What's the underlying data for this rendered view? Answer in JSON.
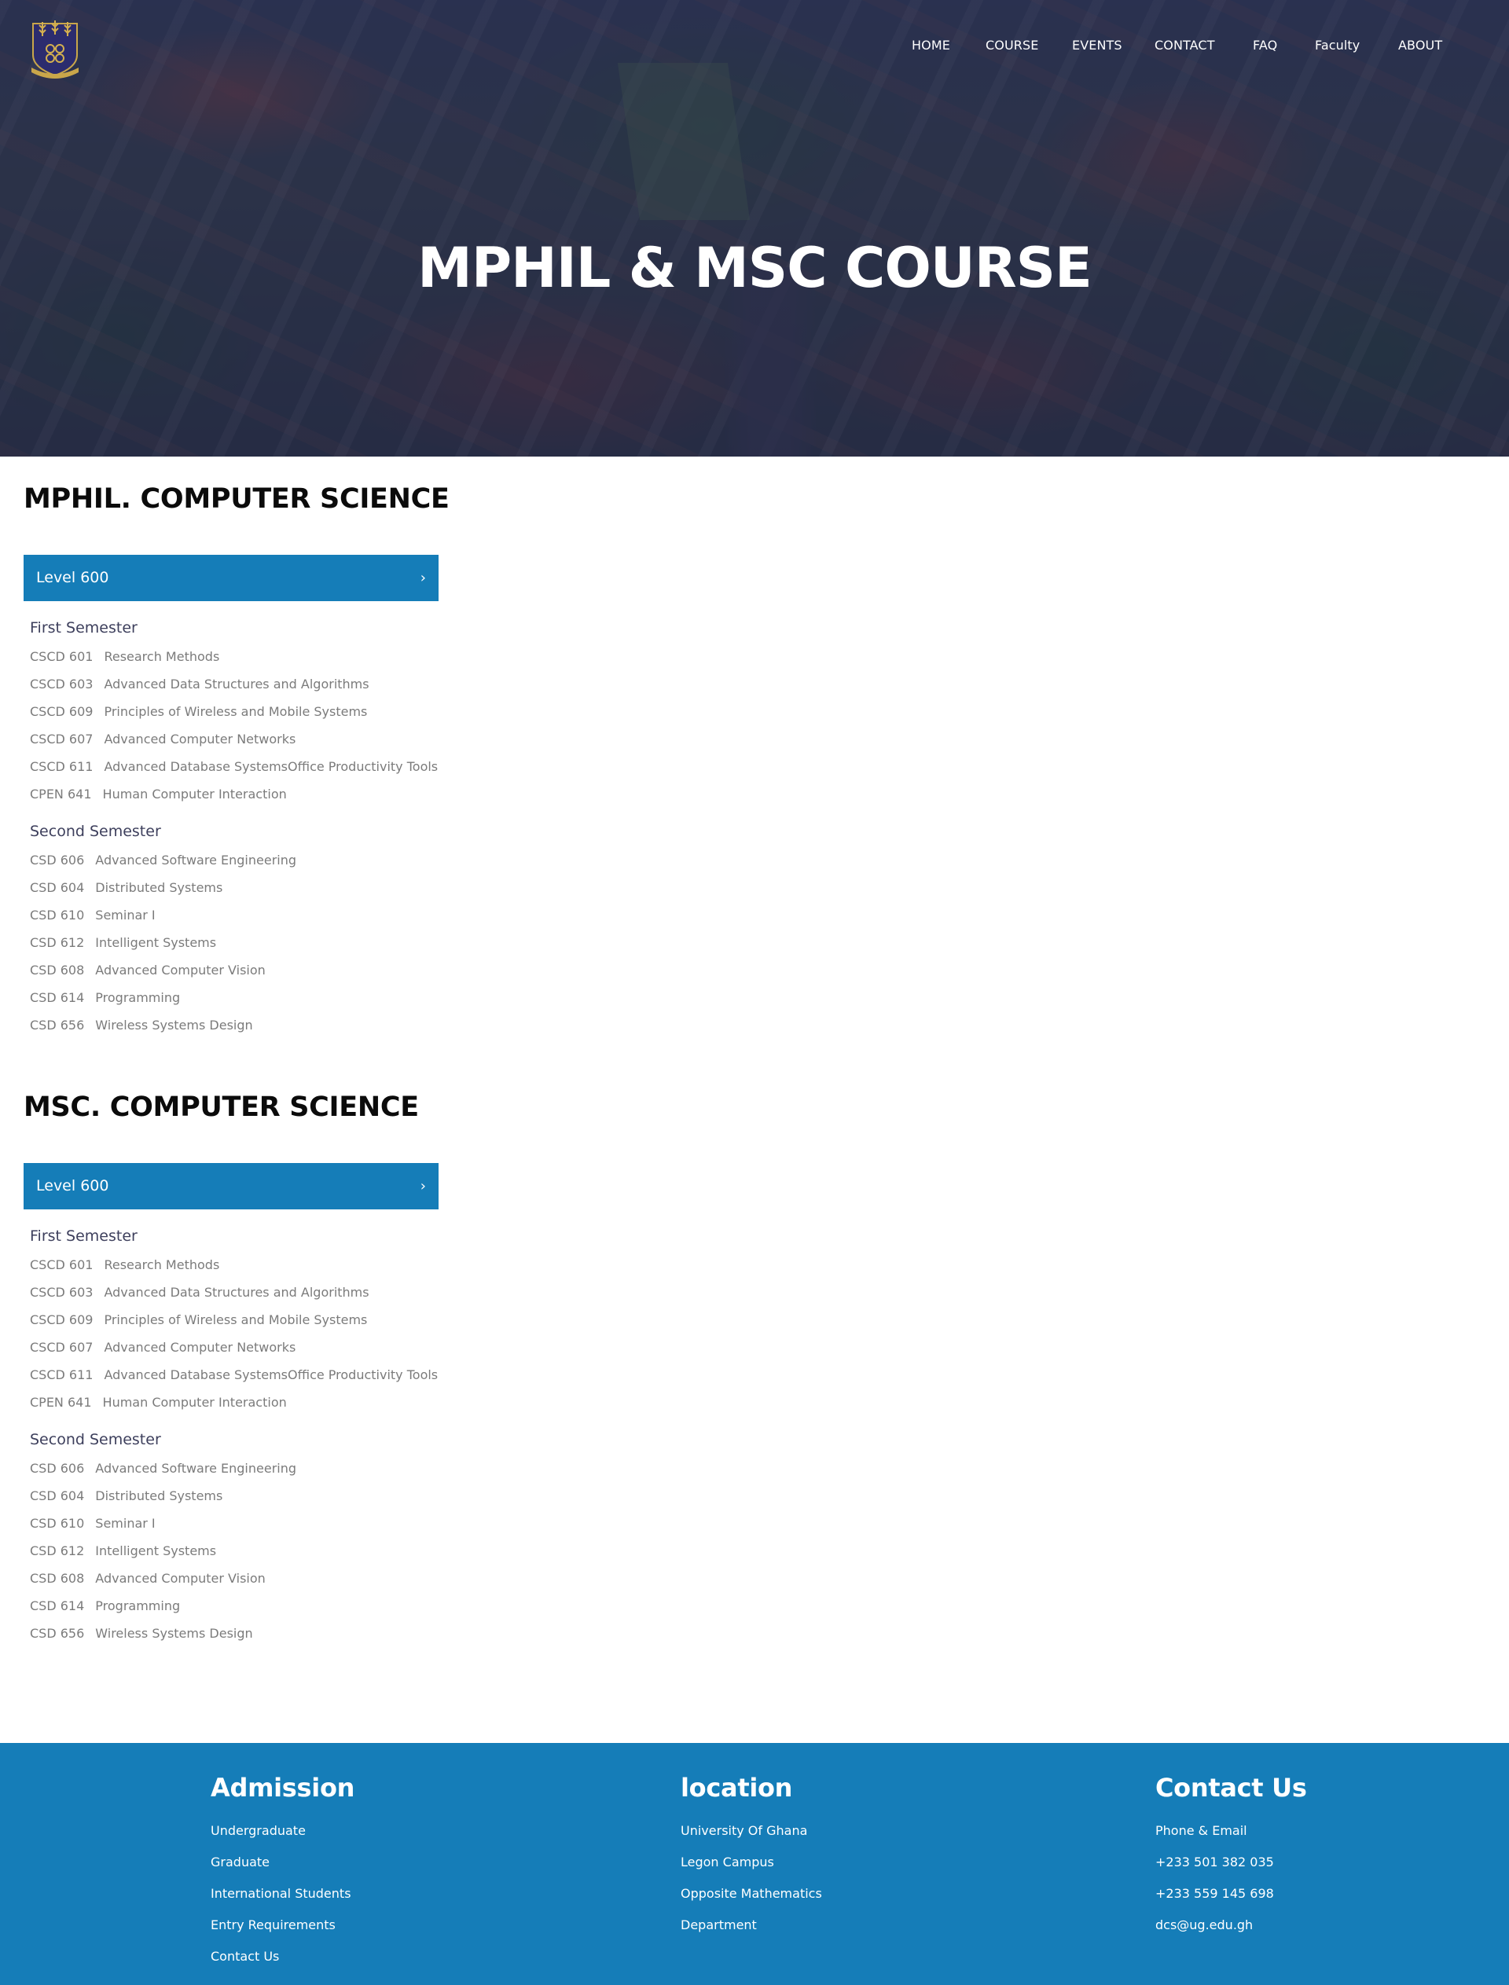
{
  "nav": {
    "items": [
      "HOME",
      "COURSE",
      "EVENTS",
      "CONTACT",
      "FAQ",
      "Faculty",
      "ABOUT"
    ]
  },
  "hero": {
    "title": "MPHIL & MSC COURSE"
  },
  "programs": [
    {
      "title": "MPHIL. COMPUTER SCIENCE",
      "level": "Level 600",
      "chevron": "›",
      "first_semester": {
        "title": "First Semester",
        "courses": [
          {
            "code": "CSCD 601",
            "name": "Research Methods"
          },
          {
            "code": "CSCD 603",
            "name": "Advanced Data Structures and Algorithms"
          },
          {
            "code": "CSCD 609",
            "name": "Principles of Wireless and Mobile Systems"
          },
          {
            "code": "CSCD 607",
            "name": "Advanced Computer Networks"
          },
          {
            "code": "CSCD 611",
            "name": "Advanced Database SystemsOffice Productivity Tools"
          },
          {
            "code": "CPEN 641",
            "name": "Human Computer Interaction"
          }
        ]
      },
      "second_semester": {
        "title": "Second Semester",
        "courses": [
          {
            "code": "CSD 606",
            "name": "Advanced Software Engineering"
          },
          {
            "code": "CSD 604",
            "name": "Distributed Systems"
          },
          {
            "code": "CSD 610",
            "name": "Seminar I"
          },
          {
            "code": "CSD 612",
            "name": "Intelligent Systems"
          },
          {
            "code": "CSD 608",
            "name": "Advanced Computer Vision"
          },
          {
            "code": "CSD 614",
            "name": "Programming"
          },
          {
            "code": "CSD 656",
            "name": "Wireless Systems Design"
          }
        ]
      }
    },
    {
      "title": "MSC. COMPUTER SCIENCE",
      "level": "Level 600",
      "chevron": "›",
      "first_semester": {
        "title": "First Semester",
        "courses": [
          {
            "code": "CSCD 601",
            "name": "Research Methods"
          },
          {
            "code": "CSCD 603",
            "name": "Advanced Data Structures and Algorithms"
          },
          {
            "code": "CSCD 609",
            "name": "Principles of Wireless and Mobile Systems"
          },
          {
            "code": "CSCD 607",
            "name": "Advanced Computer Networks"
          },
          {
            "code": "CSCD 611",
            "name": "Advanced Database SystemsOffice Productivity Tools"
          },
          {
            "code": "CPEN 641",
            "name": "Human Computer Interaction"
          }
        ]
      },
      "second_semester": {
        "title": "Second Semester",
        "courses": [
          {
            "code": "CSD 606",
            "name": "Advanced Software Engineering"
          },
          {
            "code": "CSD 604",
            "name": "Distributed Systems"
          },
          {
            "code": "CSD 610",
            "name": "Seminar I"
          },
          {
            "code": "CSD 612",
            "name": "Intelligent Systems"
          },
          {
            "code": "CSD 608",
            "name": "Advanced Computer Vision"
          },
          {
            "code": "CSD 614",
            "name": "Programming"
          },
          {
            "code": "CSD 656",
            "name": "Wireless Systems Design"
          }
        ]
      }
    }
  ],
  "footer": {
    "admission": {
      "title": "Admission",
      "links": [
        "Undergraduate",
        "Graduate",
        "International Students",
        "Entry Requirements",
        "Contact Us"
      ]
    },
    "location": {
      "title": "location",
      "lines": [
        "University Of Ghana",
        "Legon Campus",
        "Opposite Mathematics",
        "Department"
      ]
    },
    "contact": {
      "title": "Contact Us",
      "lines": [
        "Phone & Email",
        "+233 501 382 035",
        "+233 559 145 698",
        "dcs@ug.edu.gh"
      ]
    }
  },
  "colors": {
    "accent": "#157db8",
    "hero_overlay": "#161a42",
    "semester_title": "#3d3f5c",
    "course_text": "#7b7b7b"
  },
  "icons": {
    "logo": "university-crest-icon",
    "chevron": "chevron-right-icon"
  }
}
